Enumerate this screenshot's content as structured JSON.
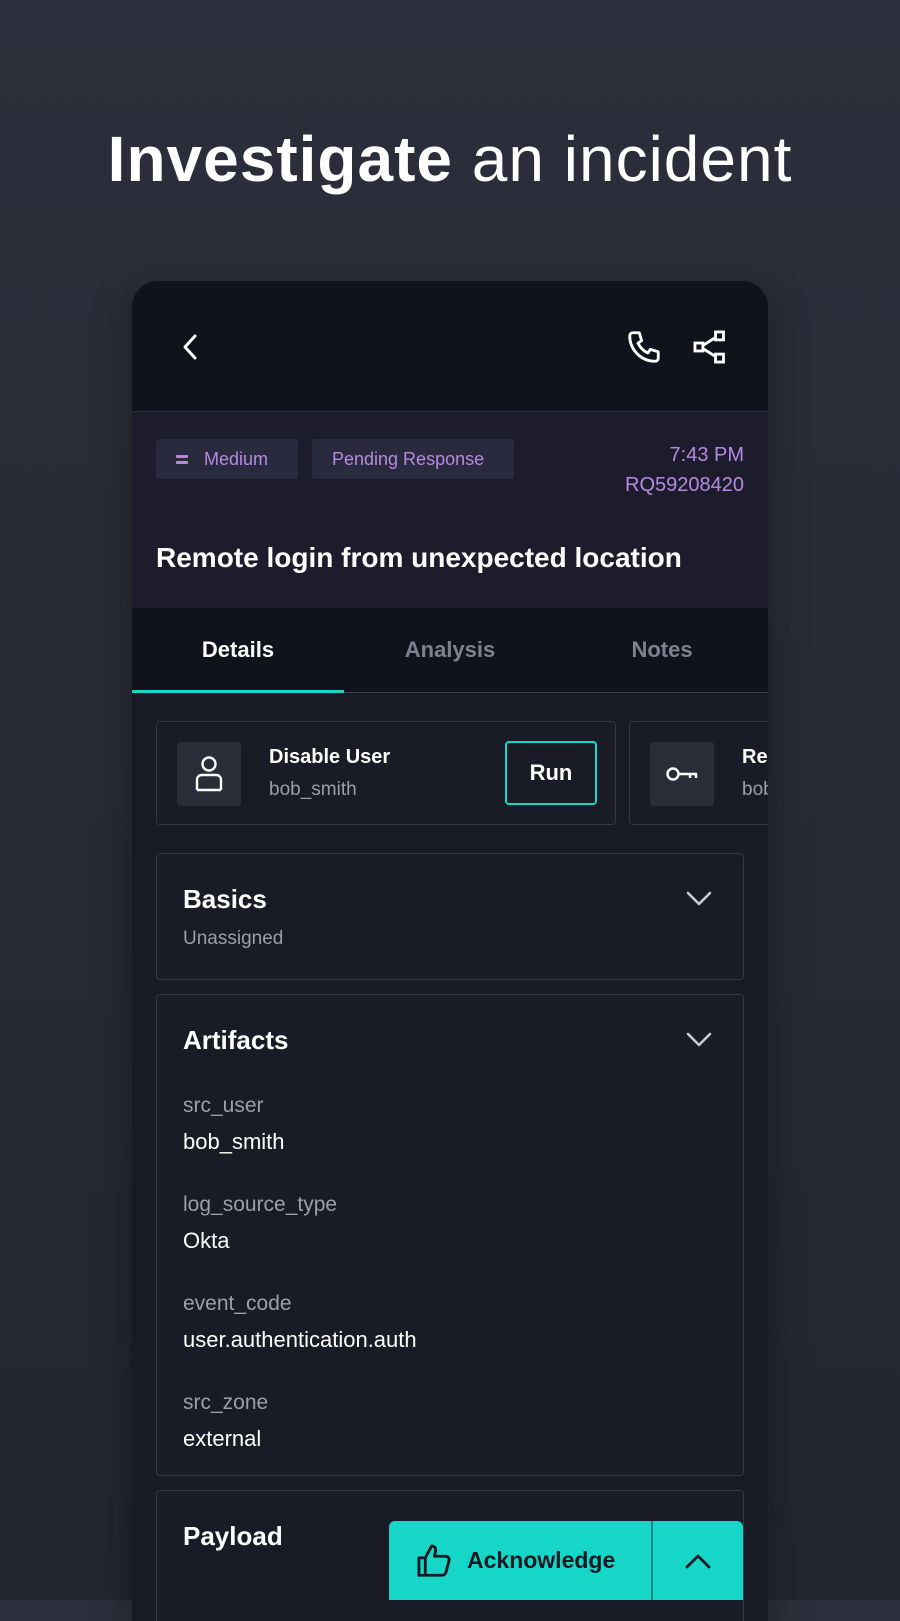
{
  "headline": {
    "bold": "Investigate",
    "light": "an incident"
  },
  "incident": {
    "priority": "Medium",
    "status": "Pending Response",
    "time": "7:43 PM",
    "id": "RQ59208420",
    "title": "Remote login from unexpected location"
  },
  "tabs": [
    {
      "label": "Details",
      "active": true
    },
    {
      "label": "Analysis",
      "active": false
    },
    {
      "label": "Notes",
      "active": false
    }
  ],
  "actions": [
    {
      "title": "Disable User",
      "subtitle": "bob_smith",
      "button": "Run",
      "icon": "user-icon"
    },
    {
      "title": "Res",
      "subtitle": "bob",
      "icon": "key-icon"
    }
  ],
  "sections": {
    "basics": {
      "title": "Basics",
      "subtitle": "Unassigned"
    },
    "artifacts": {
      "title": "Artifacts",
      "items": [
        {
          "key": "src_user",
          "value": "bob_smith"
        },
        {
          "key": "log_source_type",
          "value": "Okta"
        },
        {
          "key": "event_code",
          "value": "user.authentication.auth"
        },
        {
          "key": "src_zone",
          "value": "external"
        }
      ]
    },
    "payload": {
      "title": "Payload"
    }
  },
  "acknowledge": {
    "label": "Acknowledge"
  },
  "colors": {
    "accent": "#16d6c8",
    "badge_text": "#b58ae0",
    "background": "#2c2f3b"
  }
}
